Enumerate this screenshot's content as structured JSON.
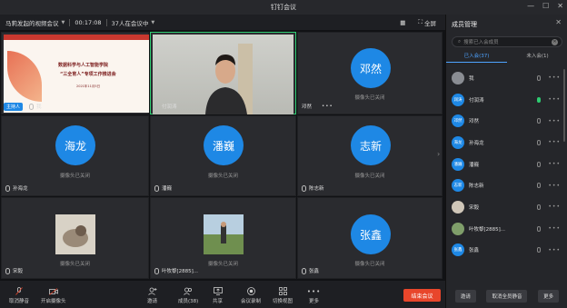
{
  "window": {
    "title": "钉钉会议",
    "min": "—",
    "max": "☐",
    "close": "✕"
  },
  "info": {
    "meeting_name": "马莉发起的视频会议",
    "elapsed": "00:17:08",
    "attendees": "37人在会议中",
    "layout_label": "",
    "fullscreen_label": "全屏"
  },
  "tiles": {
    "share": {
      "host_badge": "主持人",
      "owner": "我",
      "slide_title1": "数据科学与人工智能学院",
      "slide_title2": "“三全育人”专项工作推进会",
      "slide_date": "2021年11月5日"
    },
    "cam": {
      "name": "付润涛"
    },
    "t3": {
      "avatar": "邓然",
      "name": "邓然",
      "status": "摄像头已关闭",
      "more": "•••"
    },
    "t4": {
      "avatar": "海龙",
      "name": "孙海龙",
      "status": "摄像头已关闭"
    },
    "t5": {
      "avatar": "潘巍",
      "name": "潘巍",
      "status": "摄像头已关闭"
    },
    "t6": {
      "avatar": "志新",
      "name": "陈志新",
      "status": "摄像头已关闭"
    },
    "t7": {
      "name": "宋毅",
      "status": "摄像头已关闭"
    },
    "t8": {
      "name": "叶牧黎[2885]...",
      "status": "摄像头已关闭"
    },
    "t9": {
      "avatar": "张鑫",
      "name": "张鑫",
      "status": "摄像头已关闭"
    }
  },
  "toolbar": {
    "mute": "取消静音",
    "camera": "开启摄像头",
    "invite": "邀请",
    "members": "成员(38)",
    "share": "共享",
    "record": "会议录制",
    "view": "切换视图",
    "more": "更多",
    "end": "结束会议"
  },
  "panel": {
    "title": "成员管理",
    "search_placeholder": "搜索已入会成员",
    "tab_joined": "已入会(37)",
    "tab_unjoined": "未入会(1)",
    "members": [
      {
        "avatar": "",
        "name": "我"
      },
      {
        "avatar": "润涛",
        "name": "付润涛"
      },
      {
        "avatar": "邓然",
        "name": "邓然"
      },
      {
        "avatar": "海龙",
        "name": "孙海龙"
      },
      {
        "avatar": "潘巍",
        "name": "潘巍"
      },
      {
        "avatar": "志新",
        "name": "陈志新"
      },
      {
        "avatar": "",
        "name": "宋毅"
      },
      {
        "avatar": "",
        "name": "叶牧黎[2885]..."
      },
      {
        "avatar": "张鑫",
        "name": "张鑫"
      }
    ],
    "invite": "邀请",
    "mute_all": "取消全员静音",
    "more": "更多"
  },
  "colors": {
    "accent": "#1e88e5",
    "active_border": "#2ecc71",
    "end_button": "#e8462b"
  }
}
